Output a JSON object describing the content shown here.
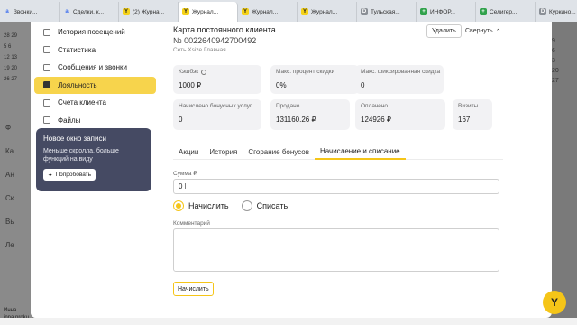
{
  "browser": {
    "tabs": [
      {
        "label": "Звонки...",
        "icon": "a-icon"
      },
      {
        "label": "Сделки, к...",
        "icon": "a-icon"
      },
      {
        "label": "(2) Журна...",
        "icon": "yclients-icon"
      },
      {
        "label": "Журнал...",
        "icon": "yclients-icon"
      },
      {
        "label": "Журнал...",
        "icon": "yclients-icon"
      },
      {
        "label": "Журнал...",
        "icon": "yclients-icon"
      },
      {
        "label": "Тульская...",
        "icon": "doc-icon"
      },
      {
        "label": "ИНФОР...",
        "icon": "sheet-icon"
      },
      {
        "label": "Селигер...",
        "icon": "sheet-icon"
      },
      {
        "label": "Куркино...",
        "icon": "doc-icon"
      }
    ]
  },
  "background": {
    "calendar": [
      "28 29",
      "5 6",
      "12 13",
      "19 20",
      "26 27"
    ],
    "nav_letters": [
      "Ф",
      "Ка",
      "Ан",
      "Ск",
      "Вь",
      "Ле"
    ],
    "footer_name": "Инна",
    "footer_sub": "inna.proku...",
    "right_numbers": [
      "9",
      "6",
      "3",
      "20",
      "27"
    ]
  },
  "sidebar": {
    "items": [
      {
        "label": "История посещений",
        "icon": "history-icon",
        "active": false
      },
      {
        "label": "Статистика",
        "icon": "chart-icon",
        "active": false
      },
      {
        "label": "Сообщения и звонки",
        "icon": "message-icon",
        "active": false
      },
      {
        "label": "Лояльность",
        "icon": "card-icon",
        "active": true
      },
      {
        "label": "Счета клиента",
        "icon": "wallet-icon",
        "active": false
      },
      {
        "label": "Файлы",
        "icon": "file-icon",
        "active": false
      }
    ],
    "promo": {
      "title": "Новое окно записи",
      "text": "Меньше скролла, больше функций на виду",
      "button": "Попробовать"
    }
  },
  "card": {
    "title": "Карта постоянного клиента",
    "number": "№ 0022640942700492",
    "network": "Сеть Xsize Главная",
    "delete_label": "Удалить",
    "collapse_label": "Свернуть"
  },
  "stats": {
    "cashback": {
      "label": "Кэшбэк",
      "value": "1000 ₽"
    },
    "max_percent": {
      "label": "Макс. процент скидки",
      "value": "0%"
    },
    "max_fixed": {
      "label": "Макс. фиксированная скидка",
      "value": "0"
    },
    "accrued": {
      "label": "Начислено бонусных услуг",
      "value": "0"
    },
    "sold": {
      "label": "Продано",
      "value": "131160.26 ₽"
    },
    "paid": {
      "label": "Оплачено",
      "value": "124926 ₽"
    },
    "visits": {
      "label": "Визиты",
      "value": "167"
    }
  },
  "content_tabs": [
    {
      "label": "Акции",
      "active": false
    },
    {
      "label": "История",
      "active": false
    },
    {
      "label": "Сгорание бонусов",
      "active": false
    },
    {
      "label": "Начисление и списание",
      "active": true
    }
  ],
  "form": {
    "amount_label": "Сумма ₽",
    "amount_value": "0",
    "radio_accrue": "Начислить",
    "radio_writeoff": "Списать",
    "comment_label": "Комментарий",
    "comment_value": "",
    "submit_label": "Начислить"
  },
  "colors": {
    "accent": "#f5c518",
    "sidebar_active": "#f7d44c",
    "promo_bg": "#454a63"
  }
}
